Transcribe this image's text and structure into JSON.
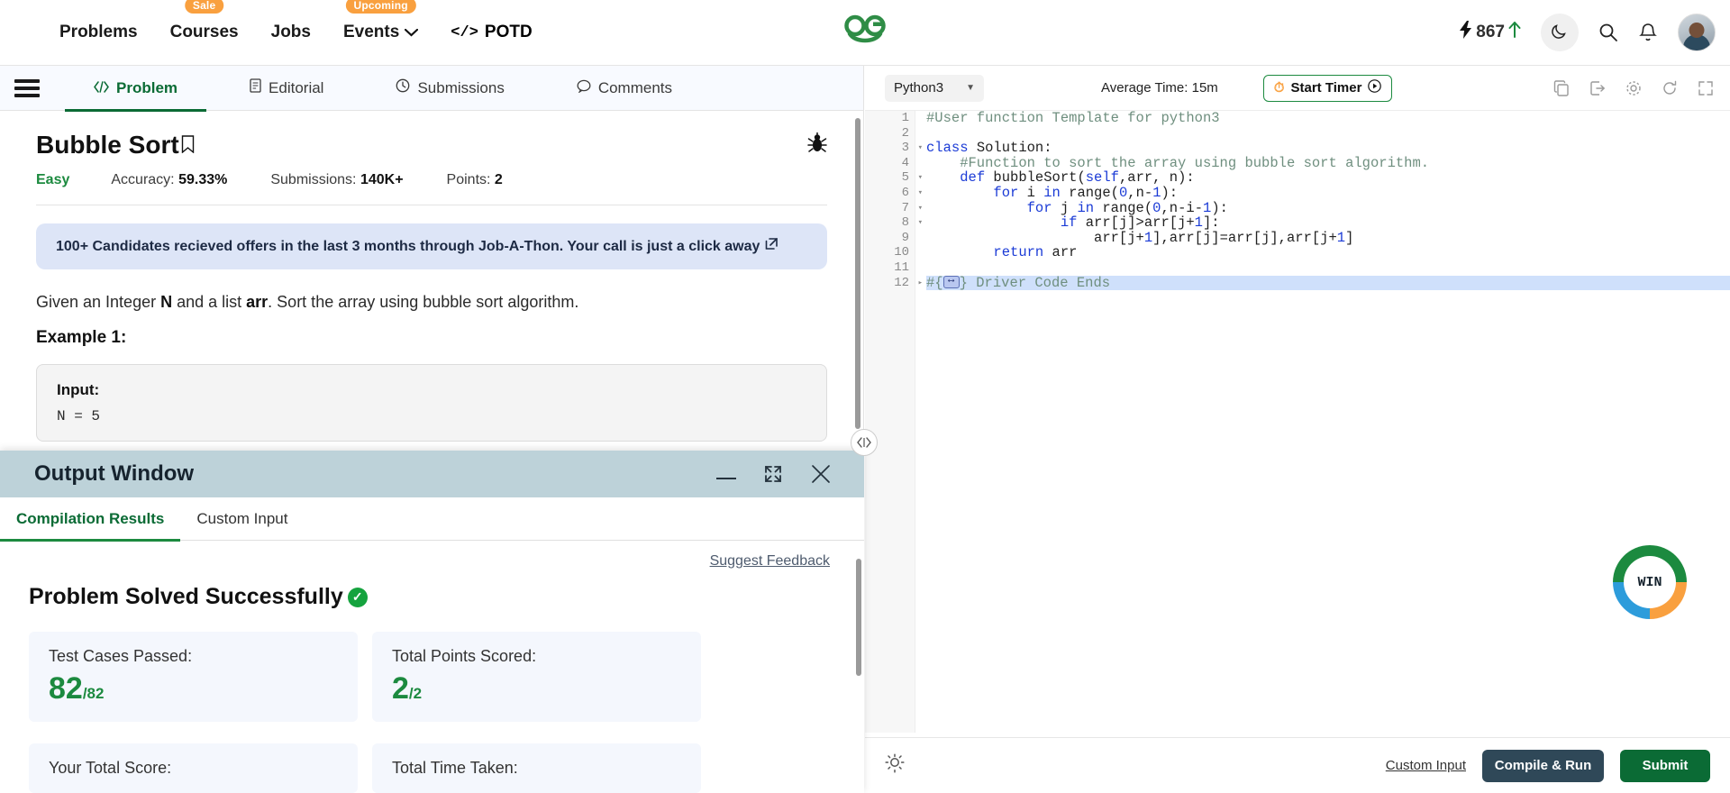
{
  "topnav": {
    "items": [
      {
        "label": "Problems",
        "badge": null,
        "caret": false
      },
      {
        "label": "Courses",
        "badge": "Sale",
        "caret": false
      },
      {
        "label": "Jobs",
        "badge": null,
        "caret": false
      },
      {
        "label": "Events",
        "badge": "Upcoming",
        "caret": true
      }
    ],
    "potd_label": "POTD",
    "potd_icon": "code-icon",
    "logo_text": "GfG",
    "streak_count": "867",
    "icons": [
      "lightning-icon",
      "up-arrow-icon",
      "moon-icon",
      "search-icon",
      "bell-icon",
      "avatar"
    ]
  },
  "left": {
    "tabs": [
      {
        "label": "Problem",
        "icon": "code-icon",
        "active": true
      },
      {
        "label": "Editorial",
        "icon": "document-icon",
        "active": false
      },
      {
        "label": "Submissions",
        "icon": "clock-icon",
        "active": false
      },
      {
        "label": "Comments",
        "icon": "comment-icon",
        "active": false
      }
    ],
    "problem": {
      "title": "Bubble Sort",
      "difficulty": "Easy",
      "accuracy_label": "Accuracy:",
      "accuracy_value": "59.33%",
      "submissions_label": "Submissions:",
      "submissions_value": "140K+",
      "points_label": "Points:",
      "points_value": "2",
      "promo": "100+ Candidates recieved offers in the last 3 months through Job-A-Thon. Your call is just a click away",
      "description_pre": "Given an Integer ",
      "description_b1": "N",
      "description_mid": " and a list ",
      "description_b2": "arr",
      "description_post": ". Sort the array using bubble sort algorithm.",
      "example_title": "Example 1:",
      "example_input_label": "Input:",
      "example_input_value": "N = 5"
    }
  },
  "output_window": {
    "title": "Output Window",
    "controls": [
      "minimize-icon",
      "maximize-icon",
      "close-icon"
    ],
    "tabs": [
      {
        "label": "Compilation Results",
        "active": true
      },
      {
        "label": "Custom Input",
        "active": false
      }
    ],
    "suggest_feedback": "Suggest Feedback",
    "status": "Problem Solved Successfully",
    "status_icon": "check-circle-icon",
    "cards": [
      {
        "label": "Test Cases Passed:",
        "value": "82",
        "suffix": "/82"
      },
      {
        "label": "Total Points Scored:",
        "value": "2",
        "suffix": "/2"
      }
    ],
    "cards_row2": [
      {
        "label": "Your Total Score:"
      },
      {
        "label": "Total Time Taken:"
      }
    ]
  },
  "editor": {
    "language": "Python3",
    "average_time": "Average Time: 15m",
    "start_timer": "Start Timer",
    "toolbar_icons": [
      "copy-icon",
      "upload-icon",
      "settings-icon",
      "reset-icon",
      "fullscreen-icon"
    ],
    "lines": [
      {
        "n": "1",
        "fold": "",
        "text": "#User function Template for python3",
        "cls": "c-com"
      },
      {
        "n": "2",
        "fold": "",
        "text": "",
        "cls": ""
      },
      {
        "n": "3",
        "fold": "▾",
        "text": "class Solution:",
        "cls": "",
        "kw": "class"
      },
      {
        "n": "4",
        "fold": "",
        "text": "    #Function to sort the array using bubble sort algorithm.",
        "cls": "c-com"
      },
      {
        "n": "5",
        "fold": "▾",
        "text": "    def bubbleSort(self,arr, n):",
        "cls": "",
        "kw": "def"
      },
      {
        "n": "6",
        "fold": "▾",
        "text": "        for i in range(0,n-1):",
        "cls": "",
        "kw": "for"
      },
      {
        "n": "7",
        "fold": "▾",
        "text": "            for j in range(0,n-i-1):",
        "cls": "",
        "kw": "for"
      },
      {
        "n": "8",
        "fold": "▾",
        "text": "                if arr[j]>arr[j+1]:",
        "cls": "",
        "kw": "if"
      },
      {
        "n": "9",
        "fold": "",
        "text": "                    arr[j+1],arr[j]=arr[j],arr[j+1]",
        "cls": ""
      },
      {
        "n": "10",
        "fold": "",
        "text": "        return arr",
        "cls": "",
        "kw": "return"
      },
      {
        "n": "11",
        "fold": "",
        "text": "",
        "cls": ""
      },
      {
        "n": "12",
        "fold": "▸",
        "text": "#{     } Driver Code Ends",
        "cls": "c-com"
      }
    ],
    "win_badge": "WIN",
    "bottom": {
      "bulb_icon": "lightbulb-icon",
      "custom_input": "Custom Input",
      "compile_run": "Compile & Run",
      "submit": "Submit"
    }
  },
  "colors": {
    "brand_green": "#0B6B35",
    "accent_orange": "#F9A03F",
    "output_header": "#bdd2d9",
    "promo_bg": "#dde5f7",
    "submit": "#0B6B35",
    "compile": "#2f4858"
  }
}
